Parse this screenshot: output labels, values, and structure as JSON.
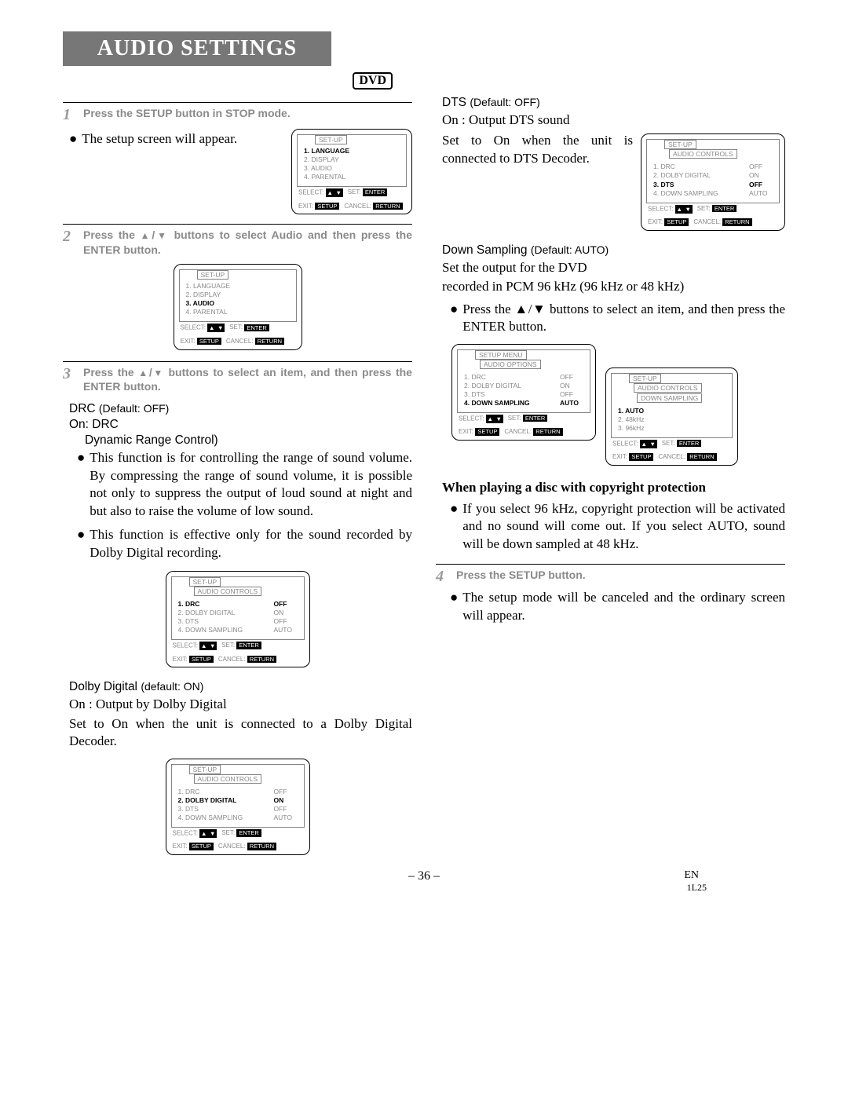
{
  "header": {
    "title": "AUDIO SETTINGS",
    "tag": "DVD"
  },
  "left": {
    "step1": {
      "num": "1",
      "text": "Press the SETUP button in STOP mode."
    },
    "step1_bullet": "The setup screen will appear.",
    "step2": {
      "num": "2",
      "text_a": "Press the ",
      "text_b": " buttons to select Audio and then press the ENTER button."
    },
    "step3": {
      "num": "3",
      "text_a": "Press the ",
      "text_b": " buttons to select an item, and then press the ENTER button."
    },
    "drc_hd_a": "DRC ",
    "drc_hd_b": "(Default: OFF)",
    "drc_on": "On: DRC",
    "drc_sub": "Dynamic Range Control)",
    "drc_p1": "This function is for controlling the range of sound volume. By compressing the range of sound volume, it is possible not only to suppress the output of loud sound at night and but also to raise the volume of low sound.",
    "drc_p2": "This function is effective only for the sound recorded by Dolby Digital recording.",
    "dolby_hd_a": "Dolby Digital ",
    "dolby_hd_b": "(default: ON)",
    "dolby_on": "On : Output by Dolby Digital",
    "dolby_p": "Set to On when the unit is connected to a Dolby Digital Decoder."
  },
  "right": {
    "dts_hd_a": "DTS ",
    "dts_hd_b": "(Default: OFF)",
    "dts_on": "On : Output DTS sound",
    "dts_p": "Set to On when the unit is connected to DTS Decoder.",
    "ds_hd_a": "Down Sampling ",
    "ds_hd_b": "(Default: AUTO)",
    "ds_p1": "Set the output for the DVD",
    "ds_p2": "recorded in PCM 96 kHz (96 kHz or 48 kHz)",
    "ds_bullet": "Press the  ▲/▼ buttons to select an item, and then press the ENTER button.",
    "copy_hd": "When playing a disc with copyright  protection",
    "copy_p": "If you select 96 kHz, copyright protection will be activated and no sound will come out. If you select AUTO, sound will be down sampled at 48 kHz.",
    "step4": {
      "num": "4",
      "text": "Press the SETUP button."
    },
    "step4_bullet": "The setup mode will be canceled and the ordinary screen will appear."
  },
  "osd": {
    "setup": "SET-UP",
    "setup_menu": "SETUP MENU",
    "audio_controls": "AUDIO CONTROLS",
    "audio_options": "AUDIO OPTIONS",
    "down_sampling": "DOWN SAMPLING",
    "main_menu": {
      "i1": "1. LANGUAGE",
      "i2": "2. DISPLAY",
      "i3": "3. AUDIO",
      "i4": "4. PARENTAL"
    },
    "audio_menu": {
      "i1": "1. DRC",
      "v1": "OFF",
      "i2": "2. DOLBY DIGITAL",
      "v2": "ON",
      "i3": "3. DTS",
      "v3": "OFF",
      "i4": "4. DOWN SAMPLING",
      "v4": "AUTO"
    },
    "ds_menu": {
      "i1": "1. AUTO",
      "i2": "2. 48kHz",
      "i3": "3. 96kHz"
    },
    "footer": {
      "select": "SELECT:",
      "set": "SET:",
      "exit": "EXIT:",
      "cancel": "CANCEL:",
      "enter": "ENTER",
      "setup": "SETUP",
      "return": "RETURN"
    }
  },
  "footer": {
    "page": "– 36 –",
    "lang": "EN",
    "code": "1L25"
  }
}
